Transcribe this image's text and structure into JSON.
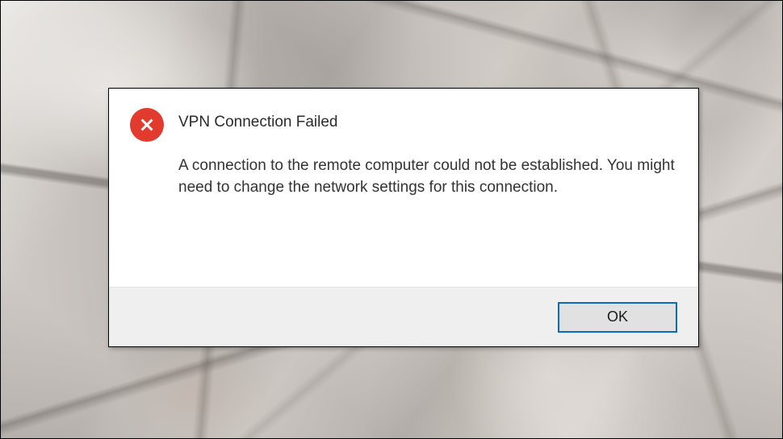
{
  "dialog": {
    "title": "VPN Connection Failed",
    "message": "A connection to the remote computer could not be established.  You might need to change the network settings for this connection.",
    "ok_label": "OK",
    "icon": "error-x-icon"
  },
  "colors": {
    "error_icon": "#e23b2e",
    "button_border": "#0a69c7",
    "footer_bg": "#efefef"
  }
}
